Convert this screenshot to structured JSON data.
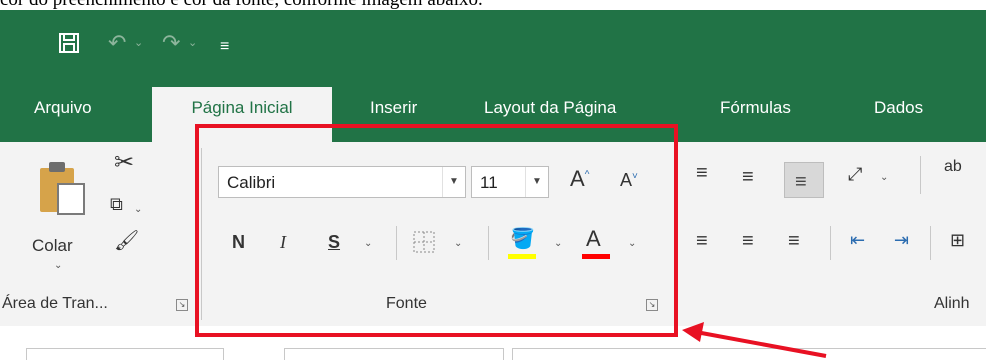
{
  "doc_text": "cor do preenchimento e cor da fonte, conforme imagem abaixo.",
  "tabs": [
    "Arquivo",
    "Página Inicial",
    "Inserir",
    "Layout da Página",
    "Fórmulas",
    "Dados"
  ],
  "clipboard": {
    "paste_label": "Colar",
    "group_label": "Área de Tran..."
  },
  "font_group": {
    "font_name": "Calibri",
    "font_size": "11",
    "bold": "N",
    "italic": "I",
    "underline": "S",
    "group_label": "Fonte",
    "fill_color": "#ffff00",
    "font_color": "#ff0000"
  },
  "align_group": {
    "label": "Alinh"
  },
  "colors": {
    "ribbon_green": "#217346",
    "highlight_red": "#e81123"
  }
}
